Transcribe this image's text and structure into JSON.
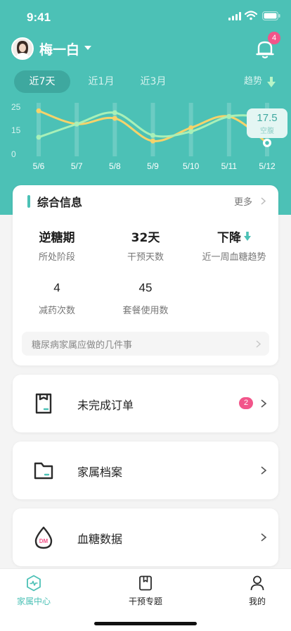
{
  "status_bar": {
    "time": "9:41"
  },
  "colors": {
    "accent": "#4cc1b6",
    "accent_dark": "#3ea89f",
    "badge": "#f2558a",
    "line_a": "#f7d36a",
    "line_b": "#a8f0b8"
  },
  "header": {
    "user_name": "梅一白",
    "notification_count": "4",
    "avatar_icon": "avatar-photo",
    "bell_icon": "bell-icon"
  },
  "range_tabs": [
    {
      "label": "近7天",
      "active": true
    },
    {
      "label": "近1月",
      "active": false
    },
    {
      "label": "近3月",
      "active": false
    }
  ],
  "trend_link": {
    "label": "趋势"
  },
  "chart_data": {
    "type": "line",
    "x": [
      "5/6",
      "5/7",
      "5/8",
      "5/9",
      "5/10",
      "5/11",
      "5/12"
    ],
    "y_ticks": [
      "25",
      "15",
      "0"
    ],
    "ylim": [
      0,
      25
    ],
    "series": [
      {
        "values": [
          23,
          16,
          19,
          7,
          14,
          20,
          6
        ]
      },
      {
        "values": [
          9,
          16,
          22,
          10,
          12,
          20,
          20
        ]
      }
    ],
    "tooltip": {
      "value": "17.5",
      "label": "空腹"
    }
  },
  "info_card": {
    "title": "综合信息",
    "more_label": "更多",
    "stats": [
      {
        "value": "逆糖期",
        "label": "所处阶段"
      },
      {
        "value": "32天",
        "label": "干预天数"
      },
      {
        "value": "下降",
        "label": "近一周血糖趋势"
      },
      {
        "value": "4",
        "label": "减药次数"
      },
      {
        "value": "45",
        "label": "套餐使用数"
      }
    ],
    "tip": "糖尿病家属应做的几件事"
  },
  "menu": [
    {
      "label": "未完成订单",
      "badge": "2",
      "icon": "order-icon"
    },
    {
      "label": "家属档案",
      "icon": "folder-icon"
    },
    {
      "label": "血糖数据",
      "icon": "blood-drop-icon",
      "icon_text": "DM"
    }
  ],
  "tab_bar": [
    {
      "label": "家属中心",
      "icon": "heartbeat-icon",
      "active": true
    },
    {
      "label": "干预专题",
      "icon": "book-icon",
      "active": false
    },
    {
      "label": "我的",
      "icon": "person-icon",
      "active": false
    }
  ]
}
